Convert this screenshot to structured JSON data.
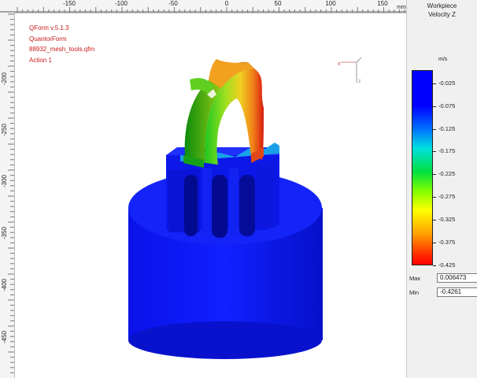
{
  "app": {
    "info_lines": [
      "QForm v.5.1.3",
      "QuantorForm",
      "88932_mesh_tools.qfm",
      "Action 1"
    ]
  },
  "ruler_top": {
    "labels": [
      "-150",
      "-100",
      "-50",
      "0",
      "50",
      "100",
      "150"
    ],
    "unit": "mm"
  },
  "ruler_left": {
    "labels": [
      "-200",
      "-250",
      "-300",
      "-350",
      "-400",
      "-450"
    ]
  },
  "legend": {
    "title": "Workpiece",
    "subtitle": "Velocity Z",
    "unit": "m/s",
    "ticks": [
      "-0.025",
      "-0.075",
      "-0.125",
      "-0.175",
      "-0.225",
      "-0.275",
      "-0.325",
      "-0.375",
      "-0.425"
    ],
    "max_label": "Max",
    "max_value": "0.006473",
    "min_label": "Min",
    "min_value": "-0.4261",
    "colors": {
      "low": "#ff0000",
      "mid": "#ffff00",
      "high": "#0000ff"
    }
  },
  "axis_triad": {
    "x_label": "x",
    "z_label": "z"
  },
  "colors": {
    "info_text": "#cc1a1a",
    "part_blue": "#0a14f0"
  }
}
